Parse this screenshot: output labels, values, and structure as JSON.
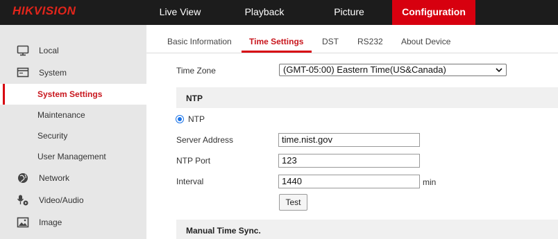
{
  "brand": "HIKVISION",
  "nav": {
    "live_view": "Live View",
    "playback": "Playback",
    "picture": "Picture",
    "configuration": "Configuration"
  },
  "sidebar": {
    "items": [
      {
        "label": "Local",
        "icon": "monitor-icon"
      },
      {
        "label": "System",
        "icon": "system-window-icon"
      },
      {
        "label": "System Settings"
      },
      {
        "label": "Maintenance"
      },
      {
        "label": "Security"
      },
      {
        "label": "User Management"
      },
      {
        "label": "Network",
        "icon": "globe-icon"
      },
      {
        "label": "Video/Audio",
        "icon": "microphone-camera-icon"
      },
      {
        "label": "Image",
        "icon": "image-icon"
      }
    ]
  },
  "tabs": {
    "basic": "Basic Information",
    "time": "Time Settings",
    "dst": "DST",
    "rs232": "RS232",
    "about": "About Device"
  },
  "form": {
    "time_zone_label": "Time Zone",
    "time_zone_value": "(GMT-05:00) Eastern Time(US&Canada)",
    "ntp_section": "NTP",
    "ntp_radio_label": "NTP",
    "server_label": "Server Address",
    "server_value": "time.nist.gov",
    "port_label": "NTP Port",
    "port_value": "123",
    "interval_label": "Interval",
    "interval_value": "1440",
    "interval_unit": "min",
    "test_label": "Test",
    "manual_section": "Manual Time Sync."
  },
  "colors": {
    "accent": "#d7000f",
    "topbar": "#1c1c1c",
    "sidebar": "#e7e7e7"
  }
}
